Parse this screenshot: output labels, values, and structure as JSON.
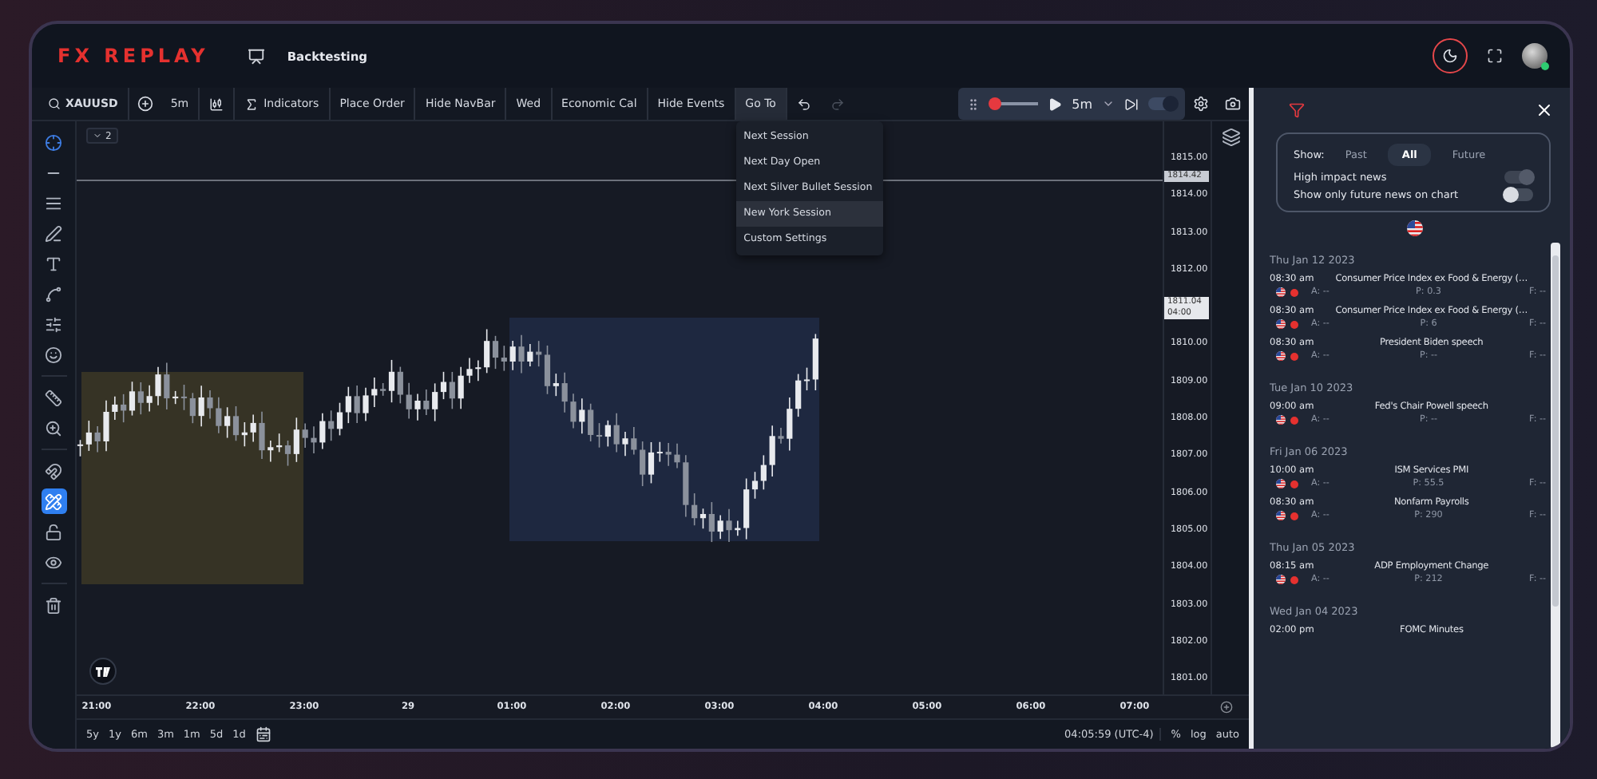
{
  "header": {
    "logo": "FX REPLAY",
    "page_title": "Backtesting",
    "dark_mode": true
  },
  "toolbar": {
    "symbol": "XAUUSD",
    "buttons": [
      {
        "kind": "interval",
        "label": "5m",
        "selected": false
      },
      {
        "kind": "chart-type",
        "selected": false
      },
      {
        "kind": "indicators",
        "label": "Indicators",
        "selected": false
      },
      {
        "kind": "text",
        "label": "Place Order",
        "selected": false
      },
      {
        "kind": "text",
        "label": "Hide NavBar",
        "selected": false
      },
      {
        "kind": "text",
        "label": "Wed",
        "selected": false
      },
      {
        "kind": "text",
        "label": "Economic Cal",
        "selected": false
      },
      {
        "kind": "text",
        "label": "Hide Events",
        "selected": false
      },
      {
        "kind": "menu",
        "label": "Go To",
        "selected": true
      }
    ],
    "undo": {
      "disabled": false
    },
    "redo": {
      "disabled": true
    },
    "replay": {
      "level": 0.1,
      "interval": "5m",
      "autoplay_on": true
    }
  },
  "goto_menu": [
    {
      "label": "Next Session",
      "selected": false
    },
    {
      "label": "Next Day Open",
      "selected": false
    },
    {
      "label": "Next Silver Bullet Session",
      "selected": false
    },
    {
      "label": "New York Session",
      "selected": true
    },
    {
      "label": "Custom Settings",
      "selected": false
    }
  ],
  "tool_groups": [
    [
      {
        "kind": "crosshair",
        "selected": true,
        "on": false
      },
      {
        "kind": "trendline",
        "selected": false,
        "on": false
      },
      {
        "kind": "fib",
        "selected": false,
        "on": false
      },
      {
        "kind": "brush",
        "selected": false,
        "on": false
      },
      {
        "kind": "text",
        "selected": false,
        "on": false
      },
      {
        "kind": "pattern",
        "selected": false,
        "on": false
      },
      {
        "kind": "forecast",
        "selected": false,
        "on": false
      },
      {
        "kind": "emoji",
        "selected": false,
        "on": false
      }
    ],
    [
      {
        "kind": "ruler",
        "selected": false,
        "on": false
      },
      {
        "kind": "zoom",
        "selected": false,
        "on": false
      }
    ],
    [
      {
        "kind": "magnet",
        "selected": false,
        "on": false
      },
      {
        "kind": "stay-drawing",
        "selected": false,
        "on": true
      },
      {
        "kind": "lock",
        "selected": false,
        "on": false
      },
      {
        "kind": "eye",
        "selected": false,
        "on": false
      }
    ],
    [
      {
        "kind": "trash",
        "selected": false,
        "on": false
      }
    ]
  ],
  "chart": {
    "series_count": "2",
    "price_axis": [
      {
        "kind": "label",
        "price": "1815.00"
      },
      {
        "kind": "line-tag",
        "price": "1814.42"
      },
      {
        "kind": "label",
        "price": "1814.00"
      },
      {
        "kind": "label",
        "price": "1813.00"
      },
      {
        "kind": "label",
        "price": "1812.00"
      },
      {
        "kind": "last-tag",
        "price": "1811.04",
        "time": "04:00"
      },
      {
        "kind": "label",
        "price": "1810.00"
      },
      {
        "kind": "label",
        "price": "1809.00"
      },
      {
        "kind": "label",
        "price": "1808.00"
      },
      {
        "kind": "label",
        "price": "1807.00"
      },
      {
        "kind": "label",
        "price": "1806.00"
      },
      {
        "kind": "label",
        "price": "1805.00"
      },
      {
        "kind": "label",
        "price": "1804.00"
      },
      {
        "kind": "label",
        "price": "1803.00"
      },
      {
        "kind": "label",
        "price": "1802.00"
      },
      {
        "kind": "label",
        "price": "1801.00"
      }
    ],
    "time_labels": [
      "21:00",
      "22:00",
      "23:00",
      "29",
      "01:00",
      "02:00",
      "03:00",
      "04:00",
      "05:00",
      "06:00",
      "07:00"
    ],
    "ranges": [
      "5y",
      "1y",
      "6m",
      "3m",
      "1m",
      "5d",
      "1d"
    ],
    "clock": "04:05:59 (UTC-4)",
    "scale_options": [
      "%",
      "log",
      "auto"
    ]
  },
  "news_panel": {
    "show_label": "Show:",
    "show_options": [
      {
        "label": "Past",
        "selected": false
      },
      {
        "label": "All",
        "selected": true
      },
      {
        "label": "Future",
        "selected": false
      }
    ],
    "toggles": [
      {
        "label": "High impact news",
        "on": true,
        "disabled": true
      },
      {
        "label": "Show only future news on chart",
        "on": false,
        "disabled": false
      }
    ],
    "groups": [
      {
        "date": "Thu Jan 12 2023",
        "events": [
          {
            "time": "08:30 am",
            "title": "Consumer Price Index ex Food & Energy (…",
            "actual": "A: --",
            "previous": "P: 0.3",
            "forecast": "F: --"
          },
          {
            "time": "08:30 am",
            "title": "Consumer Price Index ex Food & Energy (…",
            "actual": "A: --",
            "previous": "P: 6",
            "forecast": "F: --"
          },
          {
            "time": "08:30 am",
            "title": "President Biden speech",
            "actual": "A: --",
            "previous": "P: --",
            "forecast": "F: --"
          }
        ]
      },
      {
        "date": "Tue Jan 10 2023",
        "events": [
          {
            "time": "09:00 am",
            "title": "Fed's Chair Powell speech",
            "actual": "A: --",
            "previous": "P: --",
            "forecast": "F: --"
          }
        ]
      },
      {
        "date": "Fri Jan 06 2023",
        "events": [
          {
            "time": "10:00 am",
            "title": "ISM Services PMI",
            "actual": "A: --",
            "previous": "P: 55.5",
            "forecast": "F: --"
          },
          {
            "time": "08:30 am",
            "title": "Nonfarm Payrolls",
            "actual": "A: --",
            "previous": "P: 290",
            "forecast": "F: --"
          }
        ]
      },
      {
        "date": "Thu Jan 05 2023",
        "events": [
          {
            "time": "08:15 am",
            "title": "ADP Employment Change",
            "actual": "A: --",
            "previous": "P: 212",
            "forecast": "F: --"
          }
        ]
      },
      {
        "date": "Wed Jan 04 2023",
        "events": [
          {
            "time": "02:00 pm",
            "title": "FOMC Minutes"
          }
        ]
      }
    ]
  }
}
